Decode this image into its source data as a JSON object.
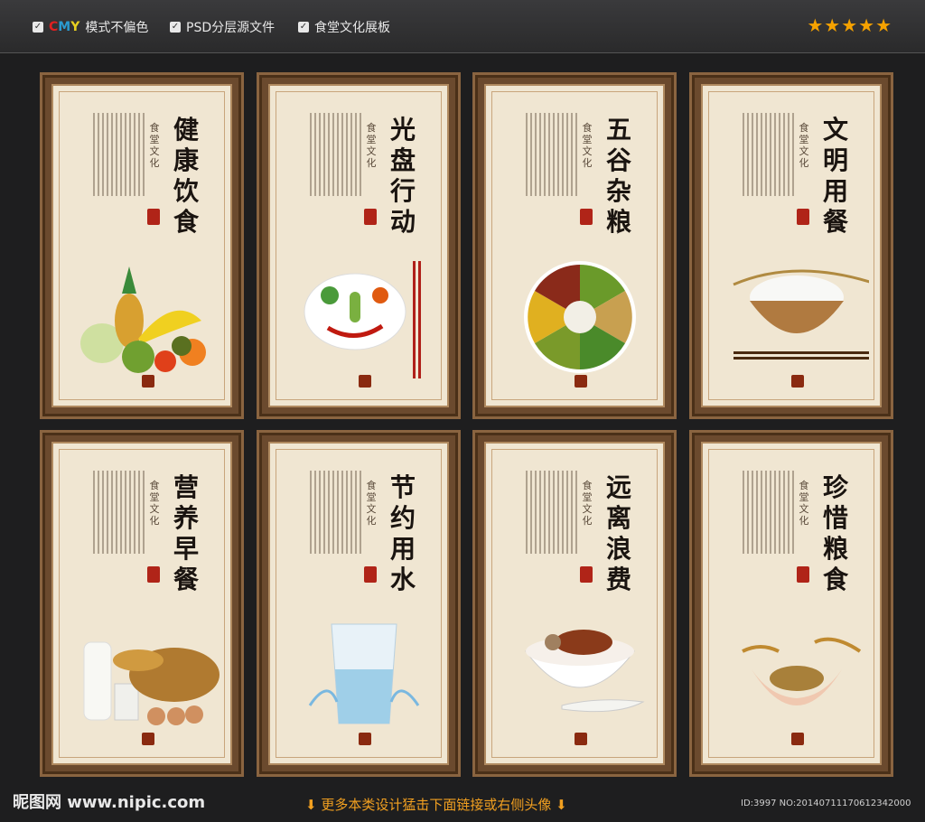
{
  "features": [
    {
      "cmy": "CMY",
      "label": "模式不偏色"
    },
    {
      "label": "PSD分层源文件"
    },
    {
      "label": "食堂文化展板"
    }
  ],
  "stars": "★★★★★",
  "boards": [
    {
      "title": "健康饮食",
      "sub": "食堂文化"
    },
    {
      "title": "光盘行动",
      "sub": "食堂文化"
    },
    {
      "title": "五谷杂粮",
      "sub": "食堂文化"
    },
    {
      "title": "文明用餐",
      "sub": "食堂文化"
    },
    {
      "title": "营养早餐",
      "sub": "食堂文化"
    },
    {
      "title": "节约用水",
      "sub": "食堂文化"
    },
    {
      "title": "远离浪费",
      "sub": "食堂文化"
    },
    {
      "title": "珍惜粮食",
      "sub": "食堂文化"
    }
  ],
  "footer": {
    "site": "昵图网 www.nipic.com",
    "more": "更多本类设计猛击下面链接或右侧头像",
    "id": "ID:3997 NO:20140711170612342000"
  },
  "colors": {
    "frame": "#6b4a2e",
    "paper": "#f0e6d2",
    "accent": "#f5a200"
  }
}
